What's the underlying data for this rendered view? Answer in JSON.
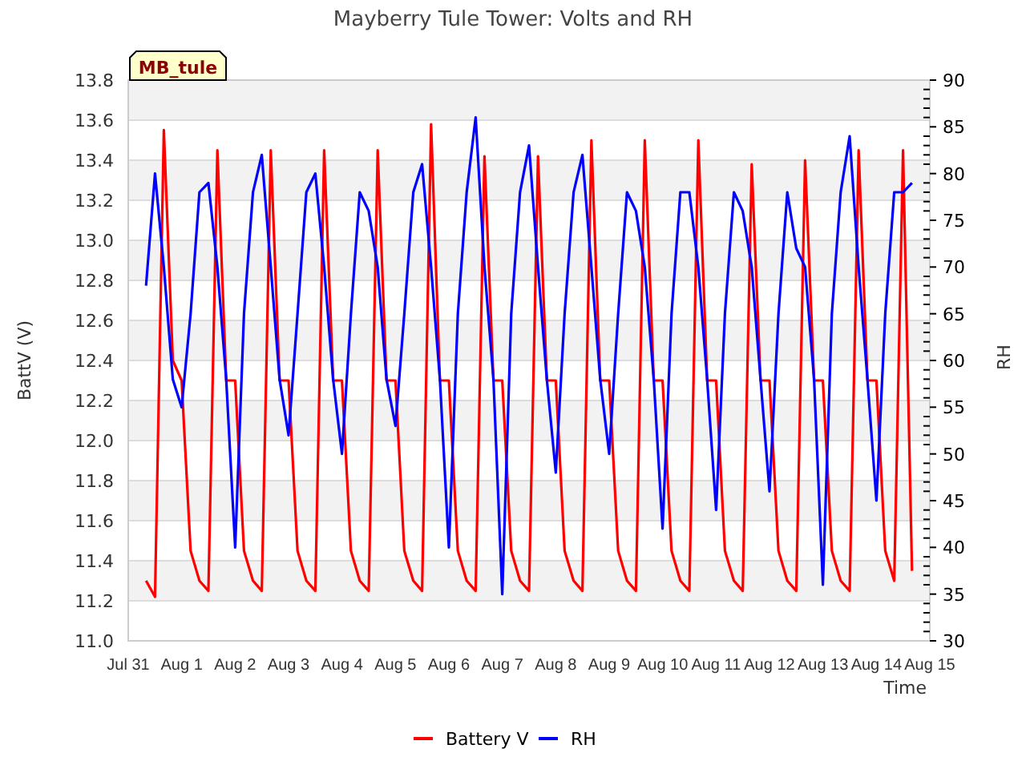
{
  "chart": {
    "badge": "MB_tule",
    "chart_data": {
      "type": "line",
      "title": "Mayberry Tule Tower: Volts and RH",
      "xlabel": "Time",
      "ylabel": "BattV (V)",
      "y2label": "RH",
      "grid": true,
      "categories": [
        "Jul 31",
        null,
        null,
        null,
        null,
        null,
        "Aug 1",
        null,
        null,
        null,
        null,
        null,
        "Aug 2",
        null,
        null,
        null,
        null,
        null,
        "Aug 3",
        null,
        null,
        null,
        null,
        null,
        "Aug 4",
        null,
        null,
        null,
        null,
        null,
        "Aug 5",
        null,
        null,
        null,
        null,
        null,
        "Aug 6",
        null,
        null,
        null,
        null,
        null,
        "Aug 7",
        null,
        null,
        null,
        null,
        null,
        "Aug 8",
        null,
        null,
        null,
        null,
        null,
        "Aug 9",
        null,
        null,
        null,
        null,
        null,
        "Aug 10",
        null,
        null,
        null,
        null,
        null,
        "Aug 11",
        null,
        null,
        null,
        null,
        null,
        "Aug 12",
        null,
        null,
        null,
        null,
        null,
        "Aug 13",
        null,
        null,
        null,
        null,
        null,
        "Aug 14",
        null,
        null,
        null,
        null,
        null,
        "Aug 15"
      ],
      "ylim": [
        11.0,
        13.8
      ],
      "y2lim": [
        30,
        90
      ],
      "yticks": [
        {
          "value": 11.0,
          "label": "11.0"
        },
        {
          "value": 11.2,
          "label": "11.2"
        },
        {
          "value": 11.4,
          "label": "11.4"
        },
        {
          "value": 11.6,
          "label": "11.6"
        },
        {
          "value": 11.8,
          "label": "11.8"
        },
        {
          "value": 12.0,
          "label": "12.0"
        },
        {
          "value": 12.2,
          "label": "12.2"
        },
        {
          "value": 12.4,
          "label": "12.4"
        },
        {
          "value": 12.6,
          "label": "12.6"
        },
        {
          "value": 12.8,
          "label": "12.8"
        },
        {
          "value": 13.0,
          "label": "13.0"
        },
        {
          "value": 13.2,
          "label": "13.2"
        },
        {
          "value": 13.4,
          "label": "13.4"
        },
        {
          "value": 13.6,
          "label": "13.6"
        },
        {
          "value": 13.8,
          "label": "13.8"
        }
      ],
      "y2ticks": [
        30,
        35,
        40,
        45,
        50,
        55,
        60,
        65,
        70,
        75,
        80,
        85,
        90
      ],
      "series": [
        {
          "name": "Battery V",
          "color": "#ff0000",
          "axis": "y",
          "values": [
            null,
            null,
            11.3,
            11.22,
            13.55,
            12.4,
            12.3,
            11.45,
            11.3,
            11.25,
            13.45,
            12.3,
            12.3,
            11.45,
            11.3,
            11.25,
            13.45,
            12.3,
            12.3,
            11.45,
            11.3,
            11.25,
            13.45,
            12.3,
            12.3,
            11.45,
            11.3,
            11.25,
            13.45,
            12.3,
            12.3,
            11.45,
            11.3,
            11.25,
            13.58,
            12.3,
            12.3,
            11.45,
            11.3,
            11.25,
            13.42,
            12.3,
            12.3,
            11.45,
            11.3,
            11.25,
            13.42,
            12.3,
            12.3,
            11.45,
            11.3,
            11.25,
            13.5,
            12.3,
            12.3,
            11.45,
            11.3,
            11.25,
            13.5,
            12.3,
            12.3,
            11.45,
            11.3,
            11.25,
            13.5,
            12.3,
            12.3,
            11.45,
            11.3,
            11.25,
            13.38,
            12.3,
            12.3,
            11.45,
            11.3,
            11.25,
            13.4,
            12.3,
            12.3,
            11.45,
            11.3,
            11.25,
            13.45,
            12.3,
            12.3,
            11.45,
            11.3,
            13.45,
            11.35,
            null,
            null
          ]
        },
        {
          "name": "RH",
          "color": "#0000ff",
          "axis": "y2",
          "values": [
            null,
            null,
            68,
            80,
            70,
            58,
            55,
            65,
            78,
            79,
            70,
            58,
            40,
            65,
            78,
            82,
            70,
            58,
            52,
            65,
            78,
            80,
            70,
            58,
            50,
            65,
            78,
            76,
            70,
            58,
            53,
            65,
            78,
            81,
            70,
            58,
            40,
            65,
            78,
            86,
            70,
            58,
            35,
            65,
            78,
            83,
            70,
            58,
            48,
            65,
            78,
            82,
            70,
            58,
            50,
            65,
            78,
            76,
            70,
            58,
            42,
            65,
            78,
            78,
            70,
            58,
            44,
            65,
            78,
            76,
            70,
            58,
            46,
            65,
            78,
            72,
            70,
            58,
            36,
            65,
            78,
            84,
            70,
            58,
            45,
            65,
            78,
            78,
            79,
            null,
            null
          ]
        }
      ]
    }
  }
}
